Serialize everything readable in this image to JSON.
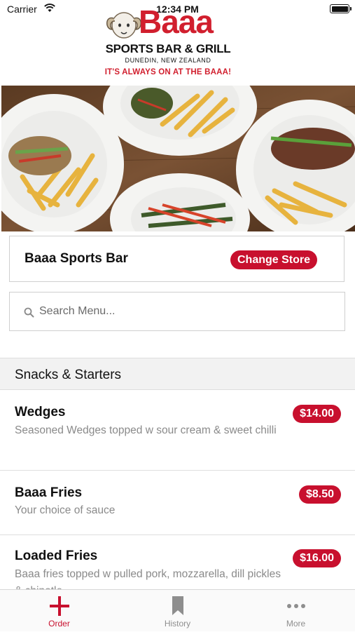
{
  "status_bar": {
    "carrier": "Carrier",
    "time": "12:34 PM"
  },
  "logo": {
    "brand": "Baaa",
    "subtitle": "SPORTS BAR & GRILL",
    "location": "DUNEDIN, NEW ZEALAND",
    "tagline": "IT'S ALWAYS ON AT THE BAAA!"
  },
  "store": {
    "name": "Baaa Sports Bar",
    "change_label": "Change Store"
  },
  "search": {
    "placeholder": "Search Menu..."
  },
  "section": {
    "title": "Snacks & Starters"
  },
  "menu_items": [
    {
      "name": "Wedges",
      "description": "Seasoned Wedges topped w sour cream & sweet chilli",
      "price": "$14.00"
    },
    {
      "name": "Baaa Fries",
      "description": "Your choice of sauce",
      "price": "$8.50"
    },
    {
      "name": "Loaded Fries",
      "description": "Baaa fries topped w pulled pork, mozzarella, dill pickles & chipotle",
      "price": "$16.00"
    }
  ],
  "tabs": [
    {
      "label": "Order",
      "icon": "plus-icon",
      "active": true
    },
    {
      "label": "History",
      "icon": "bookmark-icon",
      "active": false
    },
    {
      "label": "More",
      "icon": "more-icon",
      "active": false
    }
  ],
  "colors": {
    "accent": "#c8102e",
    "brand_red": "#d11f2e"
  }
}
